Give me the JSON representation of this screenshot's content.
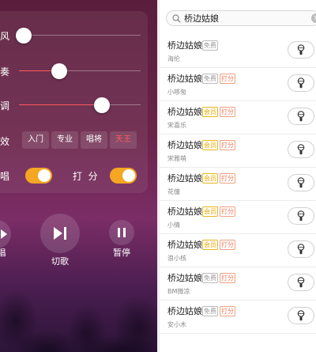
{
  "karaoke_panel": {
    "sliders": [
      {
        "label": "风",
        "level": 0.04
      },
      {
        "label": "奏",
        "level": 0.33
      },
      {
        "label": "调",
        "level": 0.68
      }
    ],
    "effects": {
      "label": "效",
      "options": [
        "入门",
        "专业",
        "唱将",
        "天王"
      ],
      "selected": "天王"
    },
    "toggles": [
      {
        "label": "唱",
        "on": true
      },
      {
        "label": "打  分",
        "on": true
      }
    ],
    "controls": [
      {
        "label": "唱",
        "icon": "play-icon"
      },
      {
        "label": "切歌",
        "icon": "next-track-icon"
      },
      {
        "label": "暂停",
        "icon": "pause-icon"
      }
    ]
  },
  "search": {
    "query": "桥边姑娘",
    "icon": "search-icon",
    "clear_icon": "clear-icon"
  },
  "tag_labels": {
    "free": "免费",
    "vip": "会员",
    "score": "打分"
  },
  "colors": {
    "accent": "#ff5a5a",
    "toggle": "#f5a623",
    "vip_tag": "#e6a800",
    "score_tag": "#ee7a55"
  },
  "songs": [
    {
      "title": "桥边姑娘",
      "artist": "海伦",
      "tags": [
        "免费"
      ]
    },
    {
      "title": "桥边姑娘",
      "artist": "小哆匆",
      "tags": [
        "免费",
        "打分"
      ]
    },
    {
      "title": "桥边姑娘",
      "artist": "宋喜乐",
      "tags": [
        "会员",
        "打分"
      ]
    },
    {
      "title": "桥边姑娘",
      "artist": "宋雅萌",
      "tags": [
        "会员",
        "打分"
      ]
    },
    {
      "title": "桥边姑娘",
      "artist": "花僮",
      "tags": [
        "会员",
        "打分"
      ]
    },
    {
      "title": "桥边姑娘",
      "artist": "小倩",
      "tags": [
        "会员",
        "打分"
      ]
    },
    {
      "title": "桥边姑娘",
      "artist": "浪小核",
      "tags": [
        "会员",
        "打分"
      ]
    },
    {
      "title": "桥边姑娘",
      "artist": "BM微凉",
      "tags": [
        "免费",
        "打分"
      ]
    },
    {
      "title": "桥边姑娘",
      "artist": "安小木",
      "tags": [
        "免费",
        "打分"
      ]
    }
  ]
}
